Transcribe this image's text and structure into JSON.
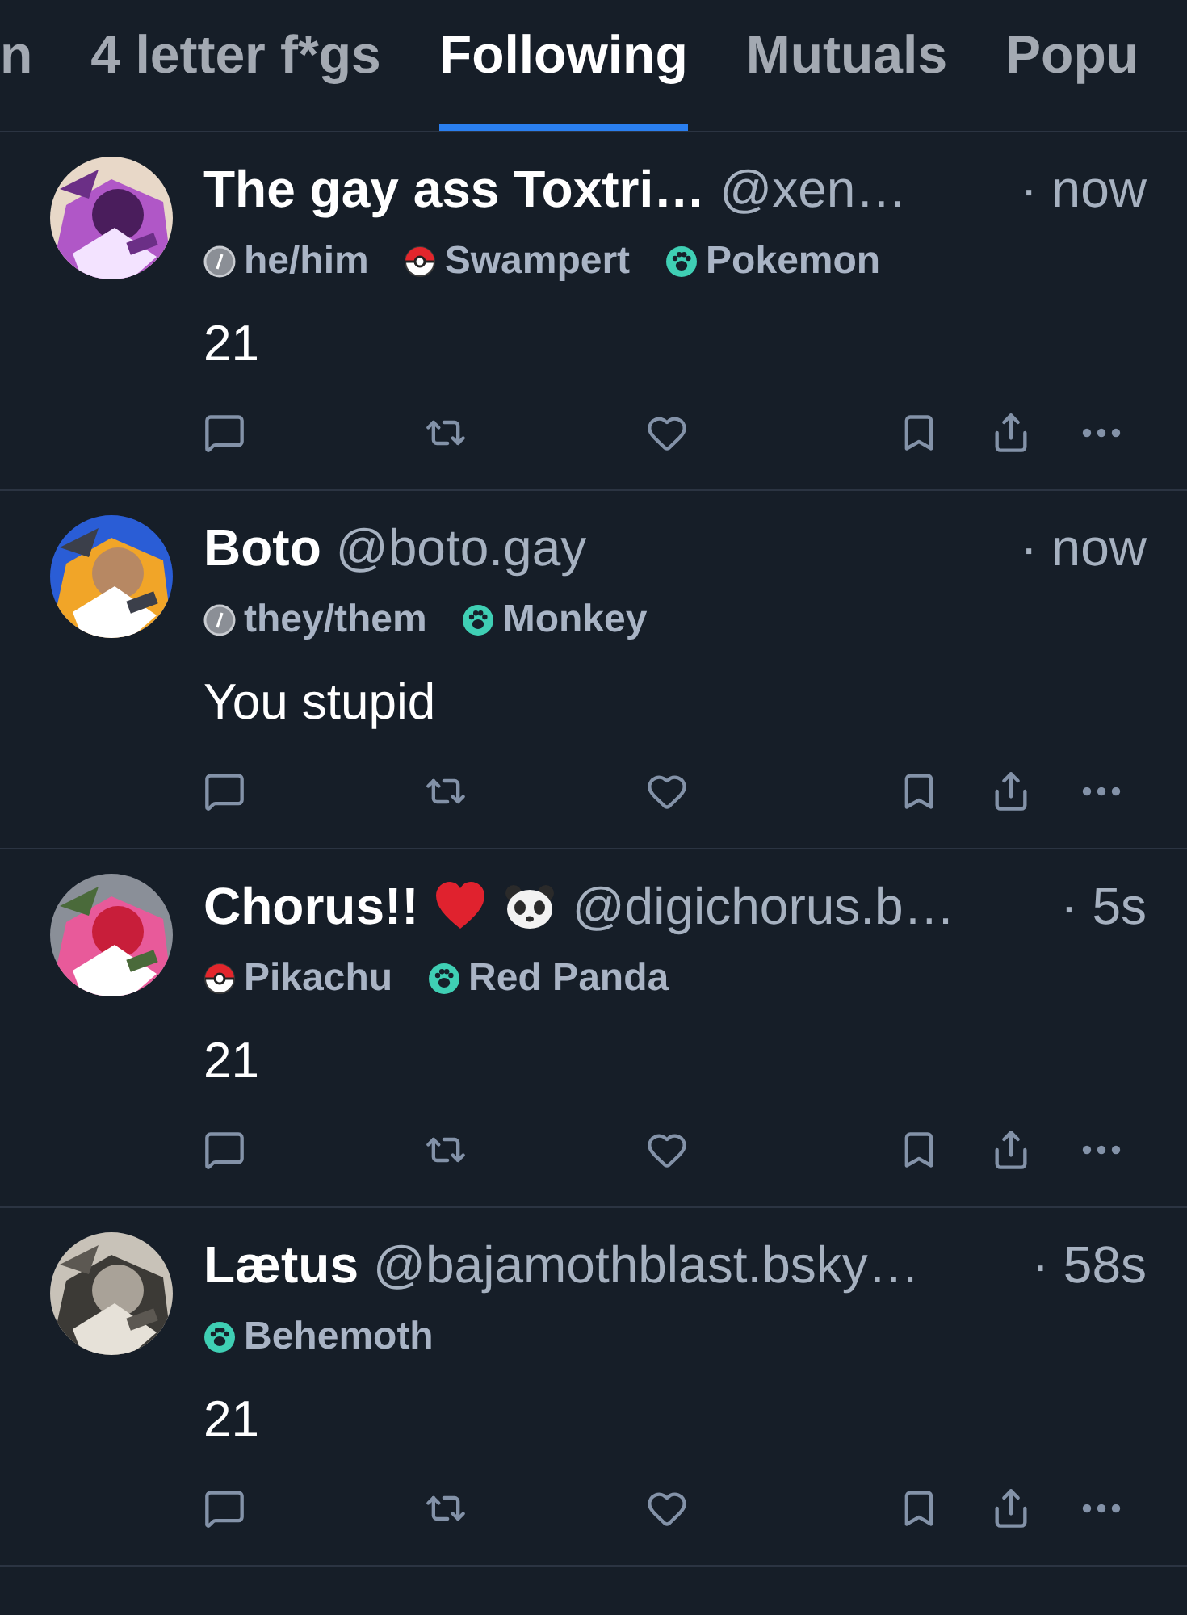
{
  "tabs": [
    {
      "label": "n",
      "selected": false
    },
    {
      "label": "4 letter f*gs",
      "selected": false
    },
    {
      "label": "Following",
      "selected": true
    },
    {
      "label": "Mutuals",
      "selected": false
    },
    {
      "label": "Popu",
      "selected": false
    }
  ],
  "posts": [
    {
      "avatar": {
        "kind": "picture"
      },
      "name": "The gay ass Toxtri…",
      "handle": "@xen…",
      "time": "· now",
      "badges": [
        {
          "kind": "pronouns",
          "label": "he/him"
        },
        {
          "kind": "pokeball",
          "label": "Swampert"
        },
        {
          "kind": "paw",
          "label": "Pokemon"
        }
      ],
      "text": "21"
    },
    {
      "avatar": {
        "kind": "picture"
      },
      "name": "Boto",
      "handle": "@boto.gay",
      "time": "· now",
      "badges": [
        {
          "kind": "pronouns",
          "label": "they/them"
        },
        {
          "kind": "paw",
          "label": "Monkey"
        }
      ],
      "text": "You stupid"
    },
    {
      "avatar": {
        "kind": "picture"
      },
      "name": "Chorus!!",
      "name_emoji": [
        {
          "kind": "heart"
        },
        {
          "kind": "panda"
        }
      ],
      "handle": "@digichorus.b…",
      "time": "· 5s",
      "badges": [
        {
          "kind": "pokeball",
          "label": "Pikachu"
        },
        {
          "kind": "paw",
          "label": "Red Panda"
        }
      ],
      "text": "21"
    },
    {
      "avatar": {
        "kind": "picture"
      },
      "name": "Lætus",
      "handle": "@bajamothblast.bsky…",
      "time": "· 58s",
      "badges": [
        {
          "kind": "paw",
          "label": "Behemoth"
        }
      ],
      "text": "21"
    }
  ]
}
